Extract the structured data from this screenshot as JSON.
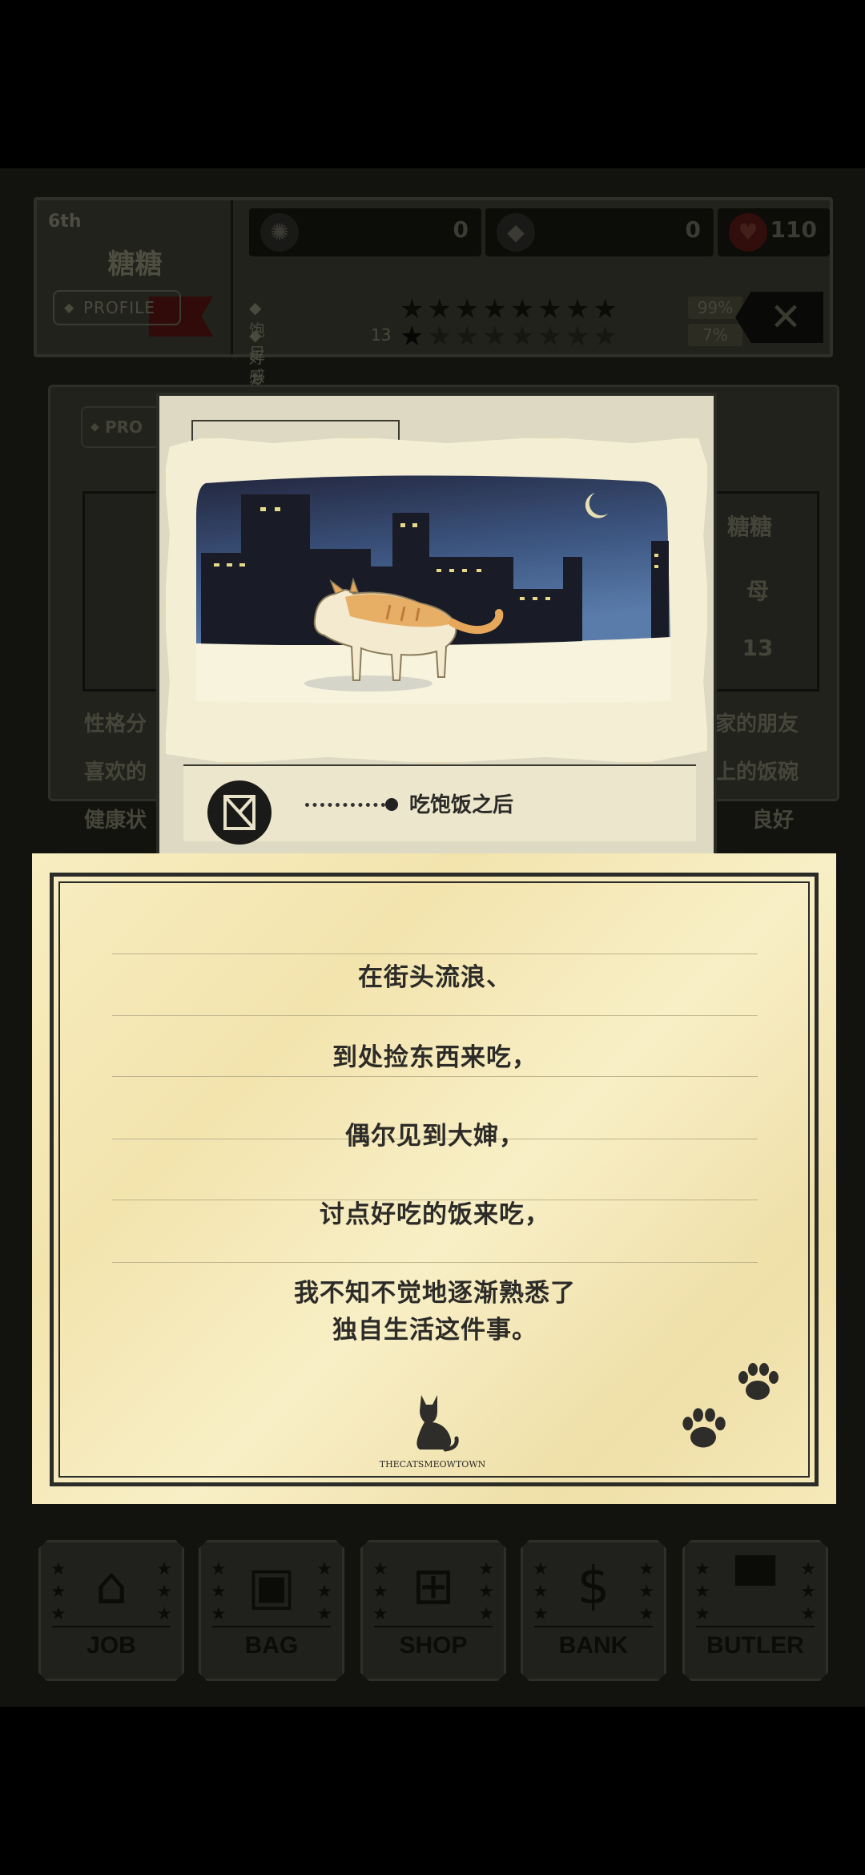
{
  "status_bar": {
    "rank": "6th",
    "cat_name": "糖糖",
    "profile_button": "PROFILE",
    "counters": [
      {
        "icon": "paw-coin-icon",
        "value": "0"
      },
      {
        "icon": "diamond-icon",
        "value": "0"
      },
      {
        "icon": "heart-icon",
        "value": "110"
      }
    ],
    "satiety_label": "饱足感",
    "satiety_pct": "99%",
    "satiety_stars": 8,
    "friend_label": "好友等级",
    "friend_level": "13",
    "friend_pct": "7%",
    "friend_stars": 1,
    "close_glyph": "✕"
  },
  "profile_panel": {
    "tab_label": "PRO",
    "name_value": "糖糖",
    "gender_value": "母",
    "age_value": "13",
    "left_labels": [
      "性格分",
      "喜欢的",
      "健康状"
    ],
    "right_values": [
      "家的朋友",
      "上的饭碗",
      "良好"
    ]
  },
  "story_card": {
    "caption": "吃饱饭之后"
  },
  "letter": {
    "lines": [
      "在街头流浪、",
      "到处捡东西来吃，",
      "偶尔见到大婶，",
      "讨点好吃的饭来吃，",
      "我不知不觉地逐渐熟悉了\n独自生活这件事。"
    ],
    "brand": "THECATSMEOWTOWN"
  },
  "bottom_menu": [
    {
      "label": "JOB",
      "icon": "house-icon",
      "glyph": "⌂"
    },
    {
      "label": "BAG",
      "icon": "bag-icon",
      "glyph": "▣"
    },
    {
      "label": "SHOP",
      "icon": "basket-icon",
      "glyph": "⊞"
    },
    {
      "label": "BANK",
      "icon": "dollar-icon",
      "glyph": "$"
    },
    {
      "label": "BUTLER",
      "icon": "top-hat-icon",
      "glyph": "▀"
    }
  ],
  "colors": {
    "letter_paper": "#f6ebbb",
    "frame": "#2b2b28",
    "night_sky_top": "#23263d",
    "night_sky_bottom": "#4a6a96"
  }
}
